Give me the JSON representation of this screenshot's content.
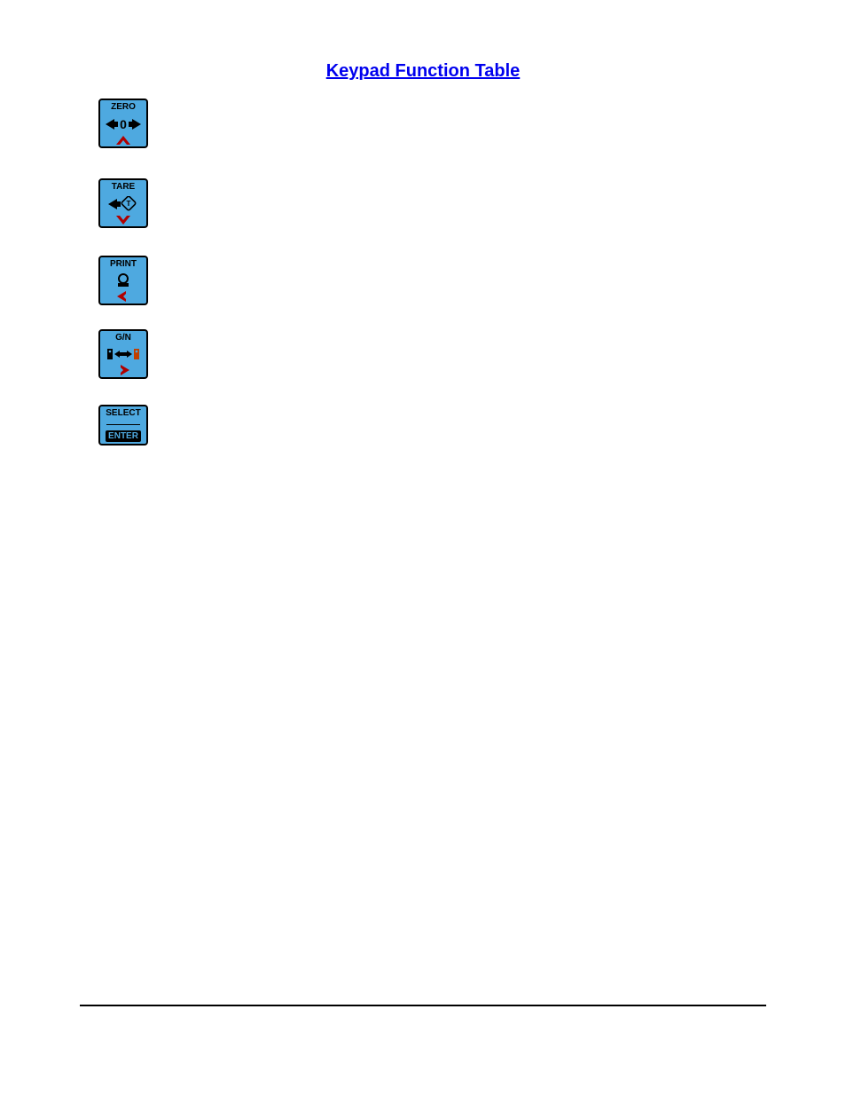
{
  "heading": "Keypad Function Table",
  "keys": {
    "zero": {
      "label": "ZERO"
    },
    "tare": {
      "label": "TARE"
    },
    "print": {
      "label": "PRINT"
    },
    "gn": {
      "label": "G/N"
    },
    "select": {
      "label_top": "SELECT",
      "label_bottom": "ENTER"
    }
  }
}
